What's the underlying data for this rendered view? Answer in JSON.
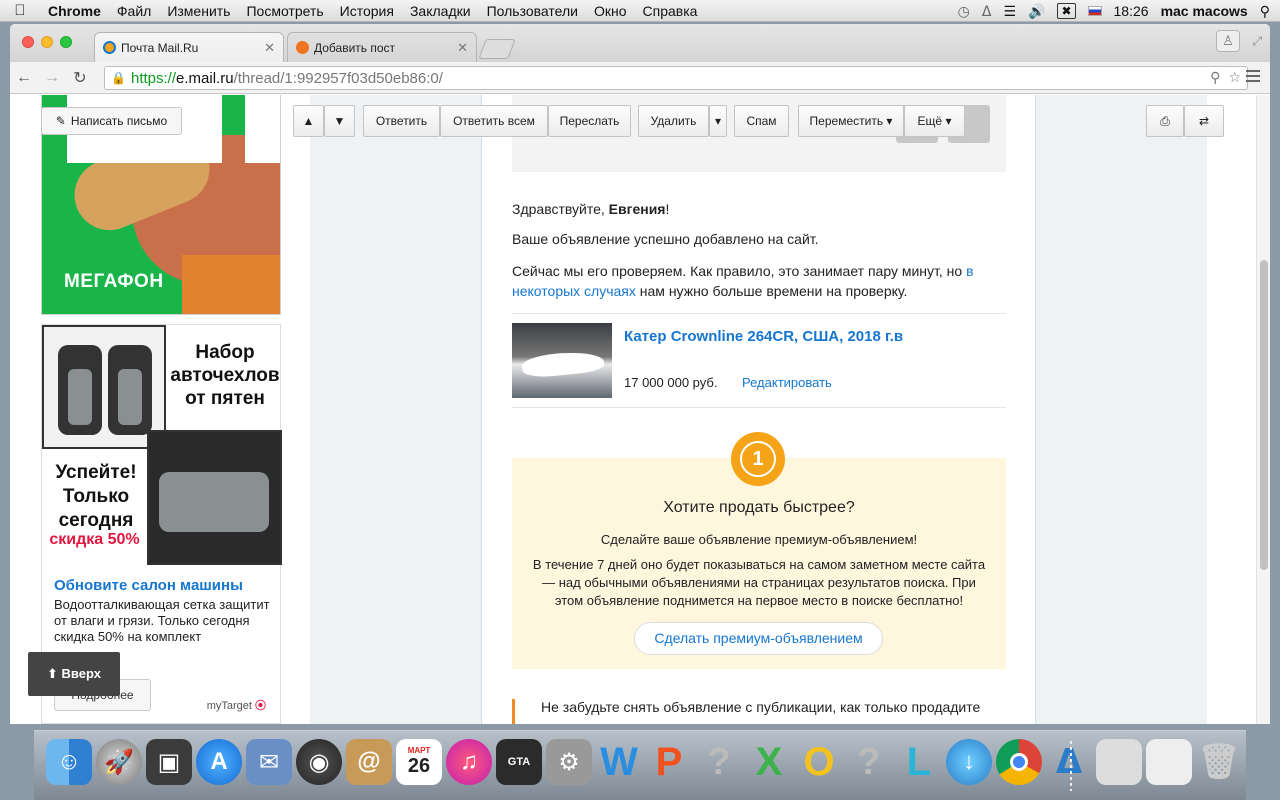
{
  "menubar": {
    "app": "Chrome",
    "items": [
      "Файл",
      "Изменить",
      "Посмотреть",
      "История",
      "Закладки",
      "Пользователи",
      "Окно",
      "Справка"
    ],
    "time": "18:26",
    "user": "mac macows"
  },
  "browser": {
    "tabs": [
      {
        "title": "Почта Mail.Ru",
        "active": true
      },
      {
        "title": "Добавить пост",
        "active": false
      }
    ],
    "url_scheme": "https://",
    "url_host": "e.mail.ru",
    "url_path": "/thread/1:992957f03d50eb86:0/"
  },
  "sidebar": {
    "compose_label": "Написать письмо",
    "ad1_logo": "МЕГАФОН",
    "ad2": {
      "headline_top": "Набор авточехлов от пятен",
      "headline_left": "Успейте! Только сегодня",
      "discount": "скидка 50%",
      "title": "Обновите салон машины",
      "description": "Водоотталкивающая сетка защитит от влаги и грязи. Только сегодня скидка 50% на комплект",
      "more_label": "Подробнее",
      "network": "myTarget"
    },
    "up_label": "Вверх"
  },
  "mail_toolbar": {
    "reply": "Ответить",
    "reply_all": "Ответить всем",
    "forward": "Переслать",
    "delete": "Удалить",
    "spam": "Спам",
    "move": "Переместить",
    "more": "Ещё"
  },
  "letter": {
    "greeting_prefix": "Здравствуйте, ",
    "greeting_name": "Евгения",
    "greeting_suffix": "!",
    "line1": "Ваше объявление успешно добавлено на сайт.",
    "line2_start": "Сейчас мы его проверяем. Как правило, это занимает пару минут, но ",
    "line2_link": "в некоторых случаях",
    "line2_end": " нам нужно больше времени на проверку.",
    "listing": {
      "title": "Катер Crownline 264CR, США, 2018 г.в",
      "price": "17 000 000 руб.",
      "edit": "Редактировать"
    },
    "promo": {
      "badge": "1",
      "heading": "Хотите продать быстрее?",
      "sub": "Сделайте ваше объявление премиум-объявлением!",
      "body": "В течение 7 дней оно будет показываться на самом заметном месте сайта — над обычными объявлениями на страницах результатов поиска. При этом объявление поднимется на первое место в поиске бесплатно!",
      "button": "Сделать премиум-объявлением"
    },
    "note": "Не забудьте снять объявление с публикации, как только продадите"
  },
  "dock": {
    "calendar_month": "МАРТ",
    "calendar_day": "26"
  }
}
